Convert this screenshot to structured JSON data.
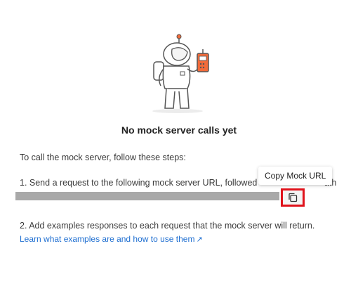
{
  "empty_state": {
    "title": "No mock server calls yet",
    "intro": "To call the mock server, follow these steps:",
    "step1_text": "1. Send a request to the following mock server URL, followed",
    "step1_tail": "ath",
    "step2_text": "2. Add examples responses to each request that the mock server will return.",
    "learn_link": "Learn what examples are and how to use them",
    "learn_link_arrow": "↗"
  },
  "copy_button": {
    "tooltip": "Copy Mock URL",
    "icon": "copy-icon"
  },
  "colors": {
    "accent_orange": "#f26b3a",
    "link_blue": "#1f6fd1",
    "highlight_red": "#e0121b",
    "url_bar_gray": "#a9a9a9"
  }
}
